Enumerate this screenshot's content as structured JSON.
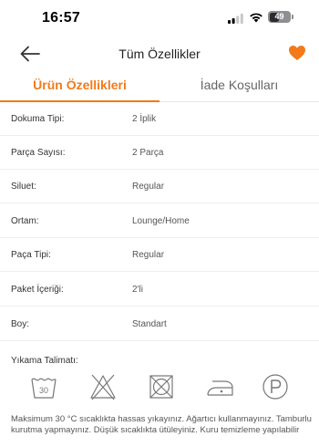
{
  "status_bar": {
    "time": "16:57",
    "battery": "49",
    "battery_level": 0.49
  },
  "header": {
    "title": "Tüm Özellikler",
    "back_icon": "arrow-left-icon",
    "favorite_icon": "heart-icon",
    "favorite_color": "#f27a1a"
  },
  "tabs": [
    {
      "label": "Ürün Özellikleri",
      "active": true
    },
    {
      "label": "İade Koşulları",
      "active": false
    }
  ],
  "accent_color": "#f27a1a",
  "specs": [
    {
      "label": "Dokuma Tipi:",
      "value": "2 İplik"
    },
    {
      "label": "Parça Sayısı:",
      "value": "2 Parça"
    },
    {
      "label": "Siluet:",
      "value": "Regular"
    },
    {
      "label": "Ortam:",
      "value": "Lounge/Home"
    },
    {
      "label": "Paça Tipi:",
      "value": "Regular"
    },
    {
      "label": "Paket İçeriği:",
      "value": "2'li"
    },
    {
      "label": "Boy:",
      "value": "Standart"
    }
  ],
  "washing": {
    "title": "Yıkama Talimatı:",
    "wash_temp": "30",
    "icons": [
      "wash-30-icon",
      "no-bleach-icon",
      "no-tumble-dry-icon",
      "iron-low-icon",
      "dry-clean-p-icon"
    ],
    "text": "Maksimum 30 °C sıcaklıkta hassas yıkayınız. Ağartıcı kullanmayınız. Tamburlu kurutma yapmayınız. Düşük sıcaklıkta ütüleyiniz. Kuru temizleme yapılabilir"
  }
}
